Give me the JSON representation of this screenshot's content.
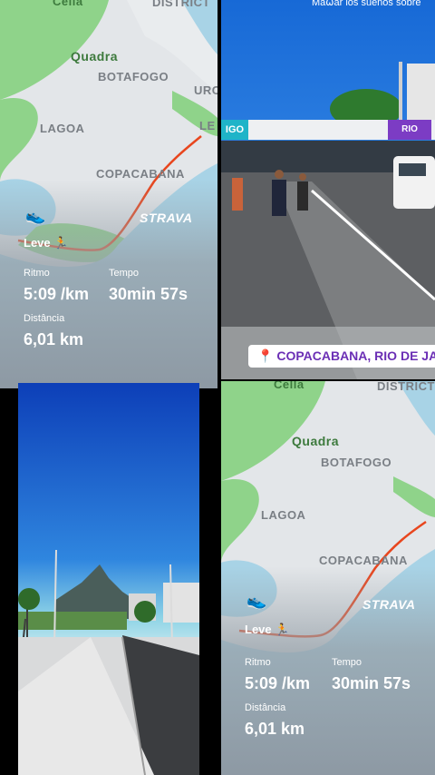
{
  "map_labels": {
    "cella": "Cella",
    "district": "DISTRICT",
    "quadra": "Quadra",
    "botafogo": "BOTAFOGO",
    "urca": "URC",
    "lagoa": "LAGOA",
    "copacabana": "COPACABANA",
    "le": "LE"
  },
  "strava": {
    "brand": "STRAVA",
    "activity": "Leve 🏃",
    "stats": [
      {
        "label": "Ritmo",
        "value": "5:09 /km"
      },
      {
        "label": "Tempo",
        "value": "30min 57s"
      },
      {
        "label": "Distância",
        "value": "6,01 km"
      }
    ]
  },
  "race_photo": {
    "top_text": "Ma⍵ar los sueños sobre",
    "banner_left": "IGO",
    "banner_right": "RIO",
    "location": "COPACABANA, RIO DE JANEIRO"
  },
  "colors": {
    "route": "#e8461e",
    "location_text": "#6b2fb5",
    "sky": "#1e74d8"
  }
}
